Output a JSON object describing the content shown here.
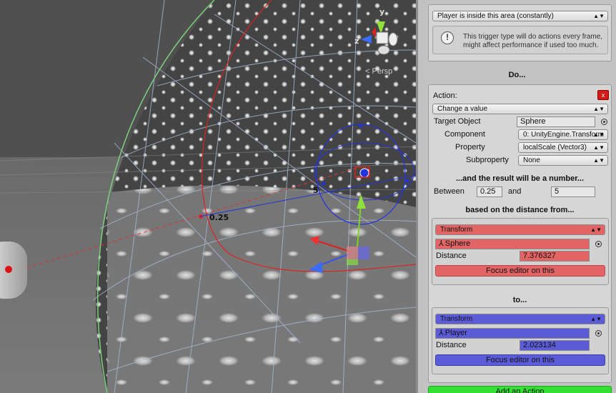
{
  "scene": {
    "axis_y": "y",
    "axis_z": "z",
    "persp_label": "Persp",
    "range_min_label": "0.25",
    "range_max_label": "5"
  },
  "trigger": {
    "selected": "Player is inside this area (constantly)",
    "help_text_line1": "This trigger type will do actions every frame,",
    "help_text_line2": "might affect performance if used too much."
  },
  "do_header": "Do...",
  "action": {
    "label": "Action:",
    "close": "x",
    "type": "Change a value",
    "target_label": "Target Object",
    "target_value": "Sphere",
    "component_label": "Component",
    "component_value": "0: UnityEngine.Transform",
    "property_label": "Property",
    "property_value": "localScale (Vector3)",
    "subproperty_label": "Subproperty",
    "subproperty_value": "None"
  },
  "result": {
    "header": "...and the result will be a number...",
    "between_label": "Between",
    "min": "0.25",
    "and_label": "and",
    "max": "5"
  },
  "from": {
    "header": "based on the distance from...",
    "type": "Transform",
    "object": "Sphere",
    "distance_label": "Distance",
    "distance": "7.376327",
    "focus_button": "Focus editor on this"
  },
  "to": {
    "header": "to...",
    "type": "Transform",
    "object": "Player",
    "distance_label": "Distance",
    "distance": "2.023134",
    "focus_button": "Focus editor on this"
  },
  "add_action": "Add an Action",
  "colors": {
    "from_accent": "#e26464",
    "to_accent": "#5c5cd9",
    "add_button": "#33e033"
  }
}
